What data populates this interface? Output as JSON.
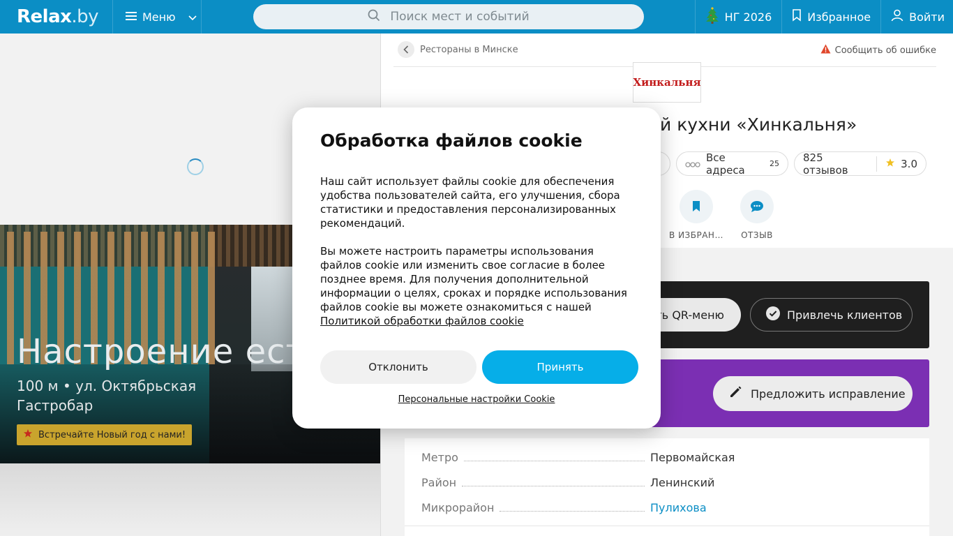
{
  "header": {
    "logo": "Relax",
    "logo_suffix": ".by",
    "menu_label": "Меню",
    "search_placeholder": "Поиск мест и событий",
    "ny_label": "НГ 2026",
    "favorites_label": "Избранное",
    "login_label": "Войти"
  },
  "hero": {
    "title": "Настроение ест",
    "distance_address": "100 м • ул. Октябрьская",
    "category": "Гастробар",
    "promo": "Встречайте Новый год с нами!"
  },
  "breadcrumb": {
    "label": "Рестораны в Минске",
    "report_error": "Сообщить об ошибке"
  },
  "place": {
    "logo_text": "Хинкальня",
    "title_fragment": "й кухни «Хинкальня»",
    "addresses_label": "Все адреса",
    "addresses_count": "25",
    "reviews_label": "825 отзывов",
    "rating": "3.0",
    "actions": [
      {
        "label": "В ИЗБРАН…",
        "icon": "bookmark-icon"
      },
      {
        "label": "ОТЗЫВ",
        "icon": "chat-bubble-icon"
      }
    ]
  },
  "owner_card": {
    "qr_button": "ть QR-меню",
    "attract_button": "Привлечь клиентов"
  },
  "suggest_card": {
    "suggest_button": "Предложить исправление"
  },
  "info": [
    {
      "label": "Метро",
      "value": "Первомайская",
      "link": false
    },
    {
      "label": "Район",
      "value": "Ленинский",
      "link": false
    },
    {
      "label": "Микрорайон",
      "value": "Пулихова",
      "link": true
    }
  ],
  "cookie_dialog": {
    "title": "Обработка файлов cookie",
    "paragraph1": "Наш сайт использует файлы cookie для обеспечения удобства пользователей сайта, его улучшения, сбора статистики и предоставления персонализированных рекомендаций.",
    "paragraph2": "Вы можете настроить параметры использования файлов cookie или изменить свое согласие в более позднее время. Для получения дополнительной информации о целях, сроках и порядке использования файлов cookie вы можете ознакомиться с нашей",
    "policy_link": "Политикой обработки файлов cookie",
    "decline_button": "Отклонить",
    "accept_button": "Принять",
    "settings_link": "Персональные настройки Cookie"
  },
  "colors": {
    "header_bg": "#0b8ec5",
    "accept_bg": "#06aee8",
    "purple_card": "#7b2fb3",
    "dark_card": "#1f1f1f",
    "promo_bg": "#c9a42d"
  }
}
